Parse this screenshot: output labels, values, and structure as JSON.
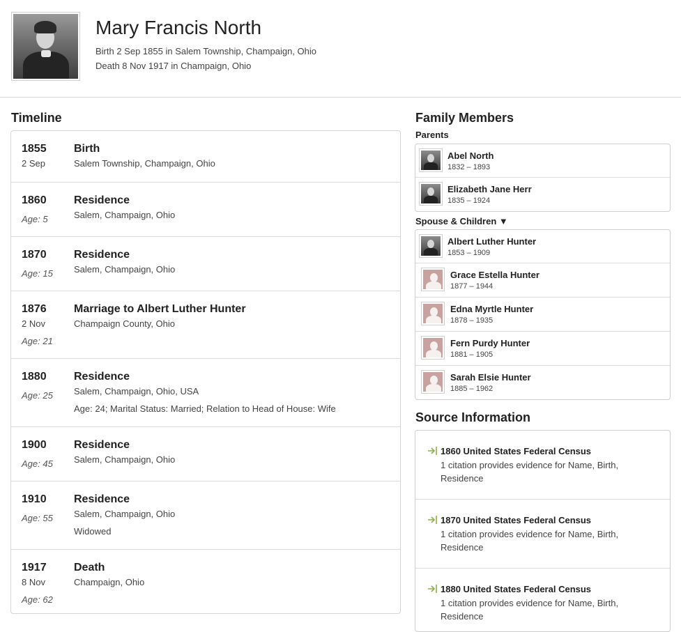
{
  "header": {
    "name": "Mary Francis North",
    "birth": "Birth 2 Sep 1855 in Salem Township, Champaign, Ohio",
    "death": "Death 8 Nov 1917 in Champaign, Ohio"
  },
  "timeline": {
    "title": "Timeline",
    "events": [
      {
        "year": "1855",
        "date": "2 Sep",
        "age": "",
        "title": "Birth",
        "place": "Salem Township, Champaign, Ohio",
        "desc": ""
      },
      {
        "year": "1860",
        "date": "",
        "age": "Age: 5",
        "title": "Residence",
        "place": "Salem, Champaign, Ohio",
        "desc": ""
      },
      {
        "year": "1870",
        "date": "",
        "age": "Age: 15",
        "title": "Residence",
        "place": "Salem, Champaign, Ohio",
        "desc": ""
      },
      {
        "year": "1876",
        "date": "2 Nov",
        "age": "Age: 21",
        "title": "Marriage to Albert Luther Hunter",
        "place": "Champaign County, Ohio",
        "desc": ""
      },
      {
        "year": "1880",
        "date": "",
        "age": "Age: 25",
        "title": "Residence",
        "place": "Salem, Champaign, Ohio, USA",
        "desc": "Age: 24; Marital Status: Married; Relation to Head of House: Wife"
      },
      {
        "year": "1900",
        "date": "",
        "age": "Age: 45",
        "title": "Residence",
        "place": "Salem, Champaign, Ohio",
        "desc": ""
      },
      {
        "year": "1910",
        "date": "",
        "age": "Age: 55",
        "title": "Residence",
        "place": "Salem, Champaign, Ohio",
        "desc": "Widowed"
      },
      {
        "year": "1917",
        "date": "8 Nov",
        "age": "Age: 62",
        "title": "Death",
        "place": "Champaign, Ohio",
        "desc": ""
      }
    ]
  },
  "family": {
    "title": "Family Members",
    "parents_label": "Parents",
    "spouse_label": "Spouse & Children ▼",
    "parents": [
      {
        "name": "Abel North",
        "dates": "1832 – 1893"
      },
      {
        "name": "Elizabeth Jane Herr",
        "dates": "1835 – 1924"
      }
    ],
    "spouse": {
      "name": "Albert Luther Hunter",
      "dates": "1853 – 1909"
    },
    "children": [
      {
        "name": "Grace Estella Hunter",
        "dates": "1877 – 1944"
      },
      {
        "name": "Edna Myrtle Hunter",
        "dates": "1878 – 1935"
      },
      {
        "name": "Fern Purdy Hunter",
        "dates": "1881 – 1905"
      },
      {
        "name": "Sarah Elsie Hunter",
        "dates": "1885 – 1962"
      }
    ]
  },
  "sources": {
    "title": "Source Information",
    "icon": "source-arrow-icon",
    "icon_color": "#8bb04a",
    "items": [
      {
        "title": "1860 United States Federal Census",
        "desc": "1 citation provides evidence for Name, Birth, Residence"
      },
      {
        "title": "1870 United States Federal Census",
        "desc": "1 citation provides evidence for Name, Birth, Residence"
      },
      {
        "title": "1880 United States Federal Census",
        "desc": "1 citation provides evidence for Name, Birth, Residence"
      }
    ]
  }
}
